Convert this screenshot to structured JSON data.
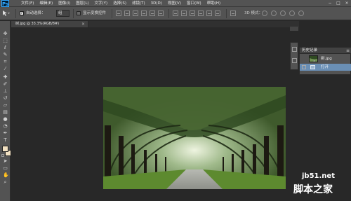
{
  "app": {
    "logo_text": "Ps"
  },
  "menu": {
    "items": [
      "文件(F)",
      "编辑(E)",
      "图像(I)",
      "图层(L)",
      "文字(Y)",
      "选择(S)",
      "滤镜(T)",
      "3D(D)",
      "视图(V)",
      "窗口(W)",
      "帮助(H)"
    ],
    "window_controls": [
      "−",
      "□",
      "×"
    ]
  },
  "options": {
    "tool_icon": "move-icon",
    "auto_select_label": "自动选择：",
    "auto_select_checked": true,
    "auto_select_value": "组",
    "show_transform_label": "显示变换控件",
    "show_transform_checked": false,
    "mode_3d_label": "3D 模式："
  },
  "document": {
    "tab_title": "树.jpg @ 33.3%(RGB/8#)",
    "tab_close": "×"
  },
  "toolbar": {
    "tools": [
      "move-icon",
      "marquee-icon",
      "lasso-icon",
      "quick-select-icon",
      "crop-icon",
      "eyedropper-icon",
      "healing-icon",
      "brush-icon",
      "stamp-icon",
      "history-brush-icon",
      "eraser-icon",
      "gradient-icon",
      "blur-icon",
      "dodge-icon",
      "pen-icon",
      "type-icon",
      "path-select-icon",
      "shape-icon",
      "hand-icon",
      "zoom-icon"
    ],
    "foreground_color": "#f2e1c2",
    "background_color": "#f2e1c2"
  },
  "history": {
    "title": "历史记录",
    "menu_icon": "≡",
    "snapshot_label": "树.jpg",
    "states": [
      "打开"
    ]
  },
  "watermark": {
    "url": "jb51.net",
    "logo_text": "脚本之家"
  }
}
